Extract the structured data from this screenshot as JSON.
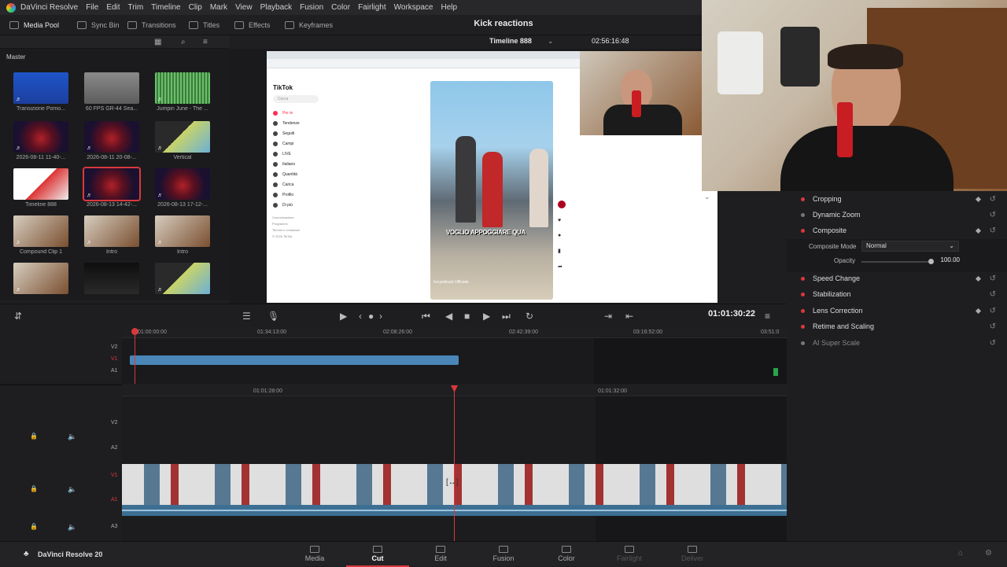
{
  "app": {
    "name": "DaVinci Resolve",
    "version_label": "DaVinci Resolve 20",
    "project_title": "Kick reactions"
  },
  "menu": [
    "DaVinci Resolve",
    "File",
    "Edit",
    "Trim",
    "Timeline",
    "Clip",
    "Mark",
    "View",
    "Playback",
    "Fusion",
    "Color",
    "Fairlight",
    "Workspace",
    "Help"
  ],
  "toolbar": {
    "media_pool": "Media Pool",
    "sync_bin": "Sync Bin",
    "transitions": "Transitions",
    "titles": "Titles",
    "effects": "Effects",
    "keyframes": "Keyframes"
  },
  "media_pool": {
    "bin": "Master",
    "clips": [
      {
        "name": "Transizione Pomo...",
        "kind": "blue",
        "selected": false
      },
      {
        "name": "60 FPS GR-44 Sea...",
        "kind": "folder",
        "selected": false
      },
      {
        "name": "Jumpin June - The ...",
        "kind": "audio",
        "selected": false
      },
      {
        "name": "2026-08-11 11-40-...",
        "kind": "stream",
        "selected": false
      },
      {
        "name": "2026-08-11 20-08-...",
        "kind": "stream",
        "selected": false
      },
      {
        "name": "Vertical",
        "kind": "collage",
        "selected": false
      },
      {
        "name": "Timeline 888",
        "kind": "timeline",
        "selected": false
      },
      {
        "name": "2026-08-13 14-42-...",
        "kind": "stream",
        "selected": true
      },
      {
        "name": "2026-08-13 17-12-...",
        "kind": "stream",
        "selected": false
      },
      {
        "name": "Compound Clip 1",
        "kind": "person",
        "selected": false
      },
      {
        "name": "Intro",
        "kind": "person",
        "selected": false
      },
      {
        "name": "Intro",
        "kind": "person",
        "selected": false
      },
      {
        "name": "",
        "kind": "person",
        "selected": false
      },
      {
        "name": "",
        "kind": "dark",
        "selected": false
      },
      {
        "name": "",
        "kind": "collage",
        "selected": false
      }
    ]
  },
  "viewer": {
    "timeline_name": "Timeline 888",
    "timecode_top": "02:56:16:48",
    "tiktok": {
      "logo": "TikTok",
      "search": "Cerca",
      "nav": [
        "Per te",
        "Tendenze",
        "Seguiti",
        "Campi",
        "LIVE",
        "Italiano",
        "Quantità",
        "Carica",
        "Profilo",
        "Di più"
      ],
      "footer": [
        "Comunicazione",
        "Programmi",
        "Termini e condizioni",
        "© 2026 TikTok"
      ],
      "caption": "VOGLIO APPOGGIARE QUA",
      "handle": "Ivo.podcast Ufficiale"
    }
  },
  "inspector": {
    "items": [
      {
        "label": "Cropping",
        "active": true
      },
      {
        "label": "Dynamic Zoom",
        "active": false
      },
      {
        "label": "Composite",
        "active": true
      },
      {
        "label": "Speed Change",
        "active": true
      },
      {
        "label": "Stabilization",
        "active": true
      },
      {
        "label": "Lens Correction",
        "active": true
      },
      {
        "label": "Retime and Scaling",
        "active": true
      },
      {
        "label": "AI Super Scale",
        "active": false
      }
    ],
    "composite_mode_label": "Composite Mode",
    "composite_mode_value": "Normal",
    "opacity_label": "Opacity",
    "opacity_value": "100.00"
  },
  "transport": {
    "timecode": "01:01:30:22"
  },
  "timeline": {
    "upper_ruler": [
      "01:00:00:00",
      "01:34:13:00",
      "02:08:26:00",
      "02:42:39:00",
      "03:16:52:00",
      "03:51:0"
    ],
    "lower_ruler": [
      "01:01:28:00",
      "01:01:32:00"
    ],
    "upper_tracks": [
      "V2",
      "V1",
      "A1"
    ],
    "lower_tracks": [
      "V2",
      "A2",
      "V1",
      "A1",
      "A3"
    ]
  },
  "pages": [
    "Media",
    "Cut",
    "Edit",
    "Fusion",
    "Color",
    "Fairlight",
    "Deliver"
  ],
  "active_page": "Cut",
  "colors": {
    "accent": "#d9383c",
    "clip_blue": "#4a86b8",
    "bg": "#1e1e21"
  }
}
